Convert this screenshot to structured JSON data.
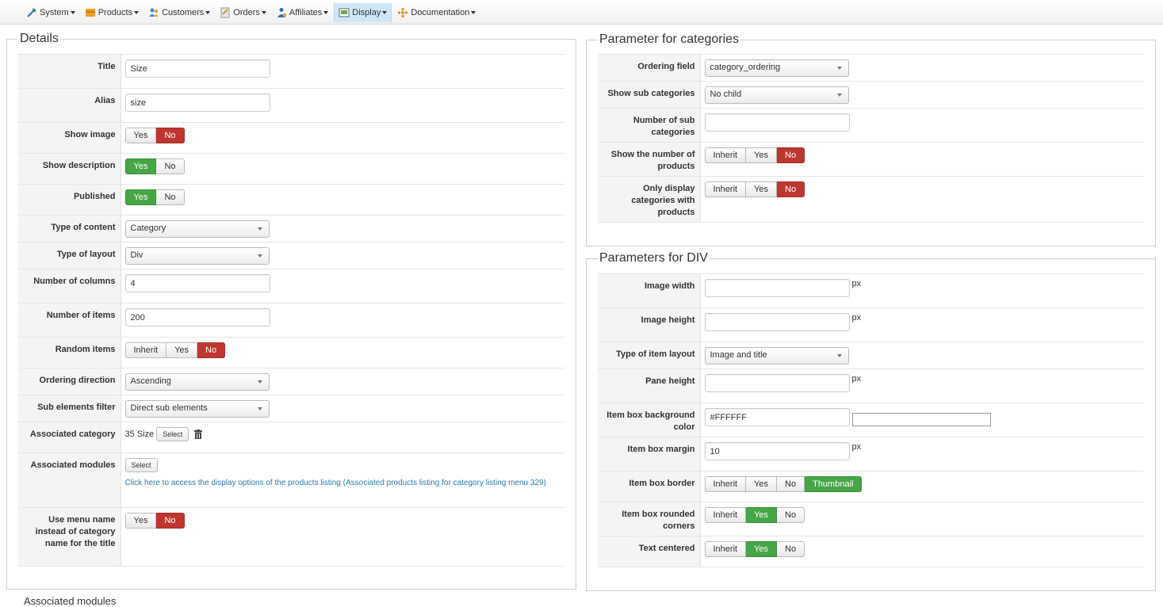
{
  "menu": [
    {
      "label": "System",
      "icon": "tools-icon",
      "active": false
    },
    {
      "label": "Products",
      "icon": "products-icon",
      "active": false
    },
    {
      "label": "Customers",
      "icon": "customers-icon",
      "active": false
    },
    {
      "label": "Orders",
      "icon": "orders-icon",
      "active": false
    },
    {
      "label": "Affiliates",
      "icon": "affiliates-icon",
      "active": false
    },
    {
      "label": "Display",
      "icon": "display-icon",
      "active": true
    },
    {
      "label": "Documentation",
      "icon": "documentation-icon",
      "active": false
    }
  ],
  "details": {
    "legend": "Details",
    "title_label": "Title",
    "title_value": "Size",
    "alias_label": "Alias",
    "alias_value": "size",
    "show_image_label": "Show image",
    "show_description_label": "Show description",
    "published_label": "Published",
    "type_content_label": "Type of content",
    "type_content_value": "Category",
    "type_layout_label": "Type of layout",
    "type_layout_value": "Div",
    "columns_label": "Number of columns",
    "columns_value": "4",
    "items_label": "Number of items",
    "items_value": "200",
    "random_label": "Random items",
    "ordering_dir_label": "Ordering direction",
    "ordering_dir_value": "Ascending",
    "sub_filter_label": "Sub elements filter",
    "sub_filter_value": "Direct sub elements",
    "assoc_cat_label": "Associated category",
    "assoc_cat_value": "35 Size",
    "select_label": "Select",
    "assoc_mod_label": "Associated modules",
    "assoc_mod_link": "Click here to access the display options of the products listing (Associated products listing for category listing menu 329)",
    "menu_name_label": "Use menu name instead of category name for the title"
  },
  "toggle": {
    "yes": "Yes",
    "no": "No",
    "inherit": "Inherit",
    "thumbnail": "Thumbnail"
  },
  "categories": {
    "legend": "Parameter for categories",
    "ordering_label": "Ordering field",
    "ordering_value": "category_ordering",
    "sub_label": "Show sub categories",
    "sub_value": "No child",
    "num_sub_label": "Number of sub categories",
    "num_sub_value": "",
    "show_num_label": "Show the number of products",
    "only_label": "Only display categories with products"
  },
  "div": {
    "legend": "Parameters for DIV",
    "width_label": "Image width",
    "width_value": "",
    "height_label": "Image height",
    "height_value": "",
    "item_layout_label": "Type of item layout",
    "item_layout_value": "Image and title",
    "pane_label": "Pane height",
    "pane_value": "",
    "bg_label": "Item box background color",
    "bg_value": "#FFFFFF",
    "margin_label": "Item box margin",
    "margin_value": "10",
    "border_label": "Item box border",
    "rounded_label": "Item box rounded corners",
    "centered_label": "Text centered",
    "unit": "px"
  },
  "footer": {
    "partial_text": "Associated modules"
  },
  "colors": {
    "active_red": "#bd362f",
    "active_green": "#46a546",
    "link": "#2a7bb1",
    "menu_active": "#cfe6f7"
  }
}
